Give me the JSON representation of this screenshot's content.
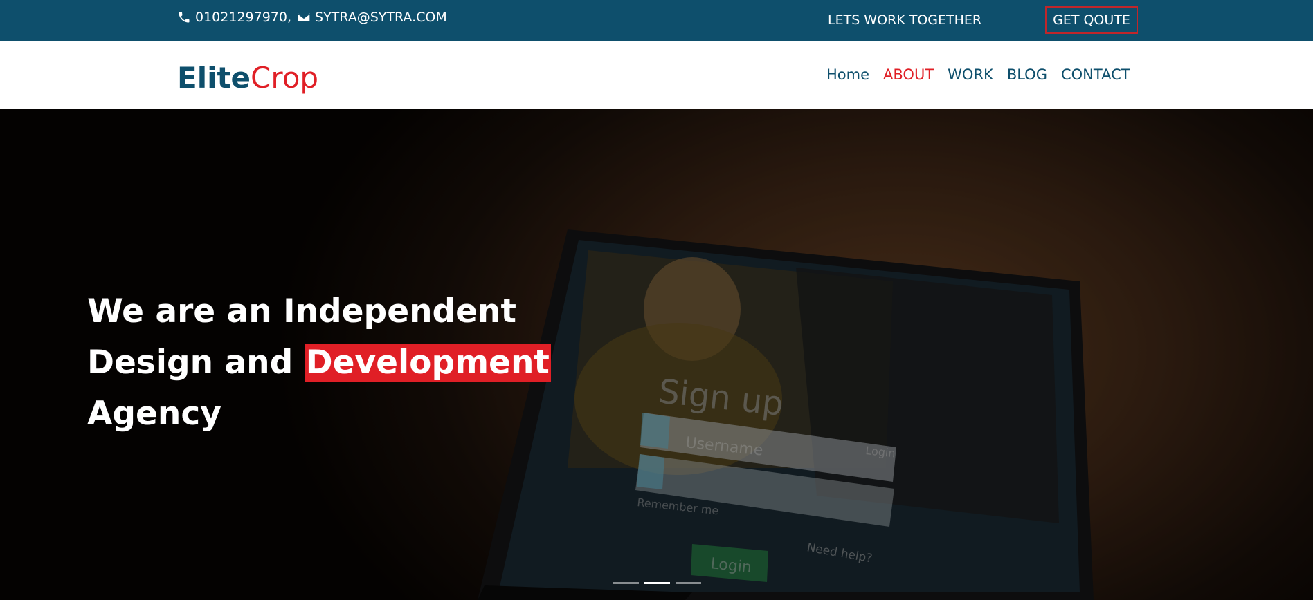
{
  "topbar": {
    "phone": "01021297970,",
    "email": "SYTRA@SYTRA.COM",
    "work_together": "LETS WORK TOGETHER",
    "get_quote": "GET QOUTE"
  },
  "brand": {
    "part1": "Elite",
    "part2": "Crop"
  },
  "nav": {
    "items": [
      "Home",
      "ABOUT",
      "WORK",
      "BLOG",
      "CONTACT"
    ],
    "active": "ABOUT"
  },
  "hero": {
    "line1": "We are an Independent",
    "line2_prefix": "Design and",
    "line2_highlight": "Development",
    "line3": "Agency",
    "image_text": {
      "signup": "Sign up",
      "login_link": "Login",
      "username_placeholder": "Username",
      "remember": "Remember me",
      "help": "Need help?",
      "login_button": "Login"
    },
    "slides": 3,
    "active_slide": 2
  },
  "colors": {
    "primary": "#0e4f6c",
    "accent": "#e01f26"
  }
}
